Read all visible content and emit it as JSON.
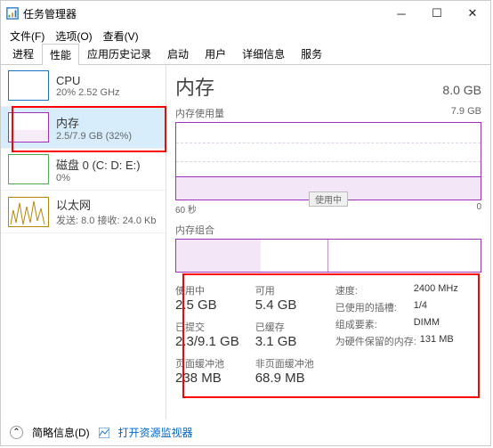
{
  "window": {
    "title": "任务管理器"
  },
  "menu": {
    "file": "文件(F)",
    "options": "选项(O)",
    "view": "查看(V)"
  },
  "tabs": [
    "进程",
    "性能",
    "应用历史记录",
    "启动",
    "用户",
    "详细信息",
    "服务"
  ],
  "active_tab": "性能",
  "sidebar": {
    "cpu": {
      "name": "CPU",
      "sub": "20% 2.52 GHz"
    },
    "memory": {
      "name": "内存",
      "sub": "2.5/7.9 GB (32%)"
    },
    "disk": {
      "name": "磁盘 0 (C: D: E:)",
      "sub": "0%"
    },
    "ethernet": {
      "name": "以太网",
      "sub": "发送: 8.0 接收: 24.0 Kb"
    }
  },
  "main": {
    "title": "内存",
    "total": "8.0 GB",
    "usage_label": "内存使用量",
    "usage_max": "7.9 GB",
    "usage_badge": "使用中",
    "axis_left": "60 秒",
    "axis_right": "0",
    "comp_label": "内存组合"
  },
  "stats": {
    "in_use": {
      "label": "使用中",
      "value": "2.5 GB"
    },
    "available": {
      "label": "可用",
      "value": "5.4 GB"
    },
    "committed": {
      "label": "已提交",
      "value": "2.3/9.1 GB"
    },
    "cached": {
      "label": "已缓存",
      "value": "3.1 GB"
    },
    "paged": {
      "label": "页面缓冲池",
      "value": "238 MB"
    },
    "nonpaged": {
      "label": "非页面缓冲池",
      "value": "68.9 MB"
    },
    "speed": {
      "label": "速度:",
      "value": "2400 MHz"
    },
    "slots": {
      "label": "已使用的插槽:",
      "value": "1/4"
    },
    "form": {
      "label": "组成要素:",
      "value": "DIMM"
    },
    "reserved": {
      "label": "为硬件保留的内存:",
      "value": "131 MB"
    }
  },
  "footer": {
    "brief": "简略信息(D)",
    "monitor": "打开资源监视器"
  }
}
